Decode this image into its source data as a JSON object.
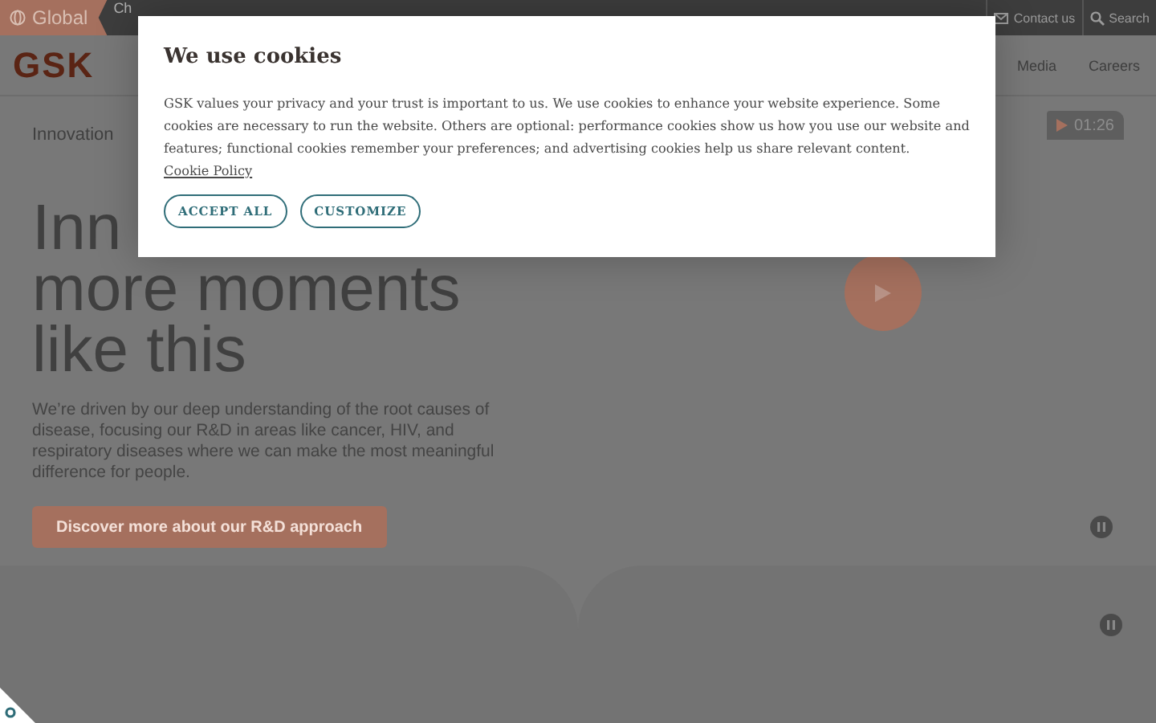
{
  "top_bar": {
    "region": "Global",
    "links": [
      {
        "label": "Ch"
      }
    ],
    "contact": "Contact us",
    "search": "Search"
  },
  "nav": {
    "logo": "GSK",
    "links": [
      "Media",
      "Careers"
    ]
  },
  "hero": {
    "eyebrow": "Innovation",
    "heading_lines": [
      "Inn",
      "more moments",
      "like this"
    ],
    "body": "We’re driven by our deep understanding of the root causes of disease, focusing our R&D in areas like cancer, HIV, and respiratory diseases where we can make the most meaningful difference for people.",
    "cta": "Discover more about our R&D approach",
    "video": {
      "duration": "01:26"
    }
  },
  "cookie_dialog": {
    "title": "We use cookies",
    "body": "GSK values your privacy and your trust is important to us. We use cookies to enhance your website experience. Some cookies are necessary to run the website. Others are optional: performance cookies show us how you use our website and features; functional cookies remember your preferences; and advertising cookies help us share relevant content.",
    "link": "Cookie Policy",
    "buttons": [
      "ACCEPT ALL",
      "CUSTOMIZE"
    ]
  }
}
